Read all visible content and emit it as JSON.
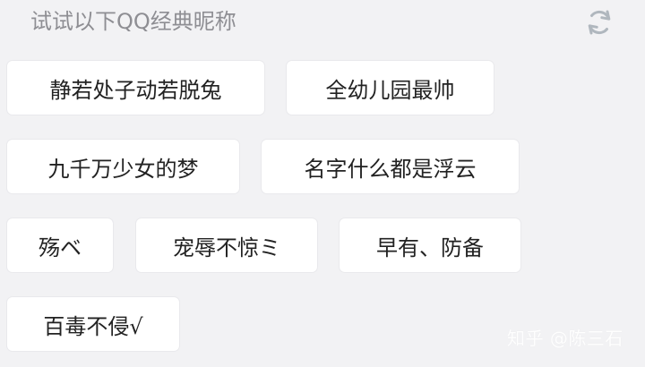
{
  "header": {
    "title": "试试以下QQ经典昵称",
    "refresh_icon": "refresh-icon",
    "icon_color": "#b0b7be"
  },
  "nicknames": [
    "静若处子动若脱兔",
    "全幼儿园最帅",
    "九千万少女的梦",
    "名字什么都是浮云",
    "殇ベ",
    "宠辱不惊ミ",
    "早有、防备",
    "百毒不侵√"
  ],
  "watermark": "知乎 @陈三石"
}
